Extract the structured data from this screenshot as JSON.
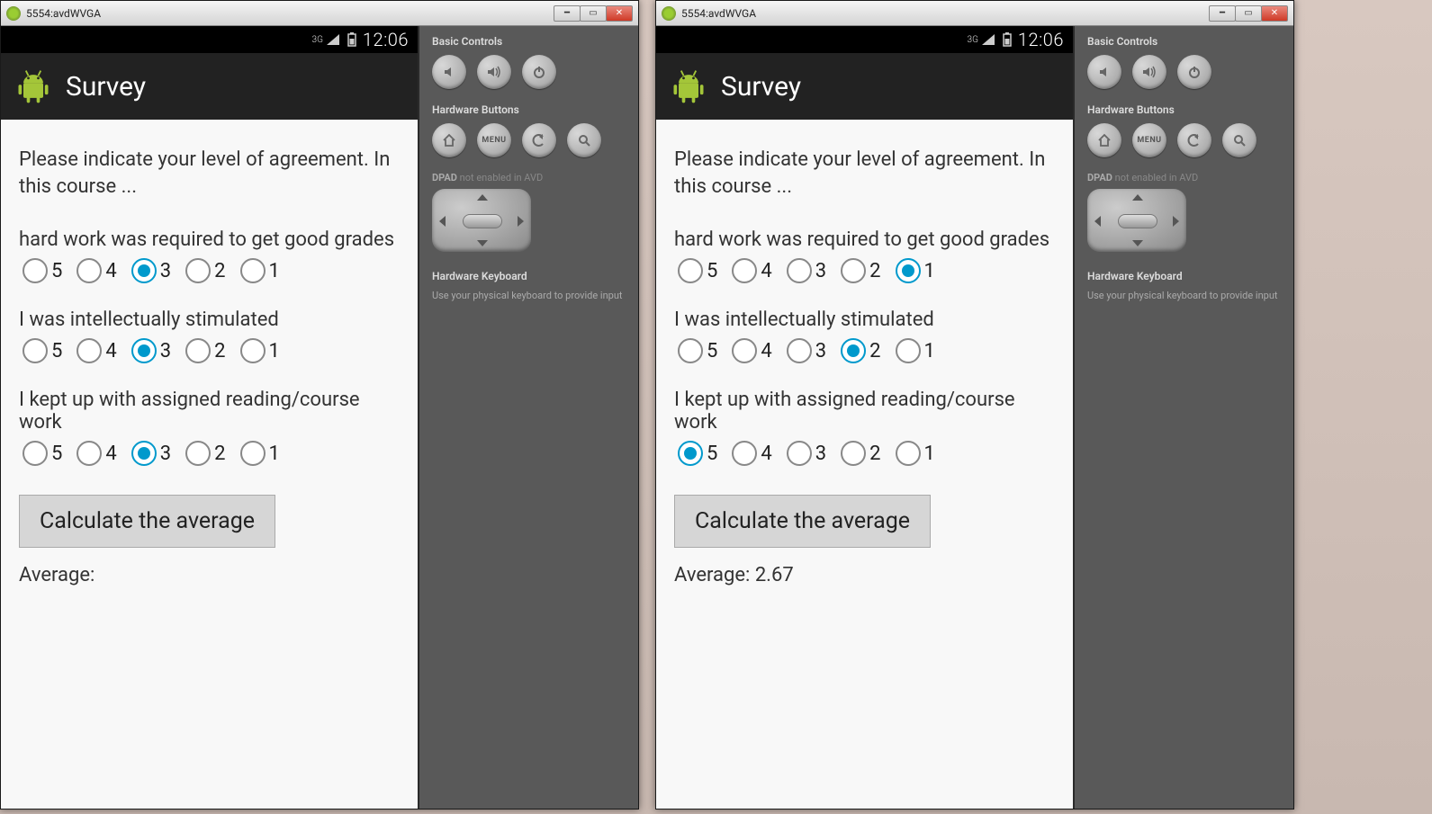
{
  "window": {
    "title": "5554:avdWVGA"
  },
  "statusbar": {
    "network": "3G",
    "time": "12:06"
  },
  "actionbar": {
    "title": "Survey"
  },
  "survey": {
    "prompt": "Please indicate your level of agreement. In this course ...",
    "options": [
      "5",
      "4",
      "3",
      "2",
      "1"
    ],
    "questions": [
      {
        "text": "hard work was required to get good grades"
      },
      {
        "text": "I was intellectually stimulated"
      },
      {
        "text": "I kept up with assigned reading/course work"
      }
    ],
    "calc_button": "Calculate the average",
    "avg_label": "Average:"
  },
  "instances": [
    {
      "selected": [
        3,
        3,
        3
      ],
      "result": ""
    },
    {
      "selected": [
        1,
        2,
        5
      ],
      "result": "2.67"
    }
  ],
  "panel": {
    "basic": "Basic Controls",
    "hardware_btns": "Hardware Buttons",
    "menu": "MENU",
    "dpad": "DPAD",
    "dpad_note": "not enabled in AVD",
    "kb_h": "Hardware Keyboard",
    "kb_note": "Use your physical keyboard to provide input"
  }
}
